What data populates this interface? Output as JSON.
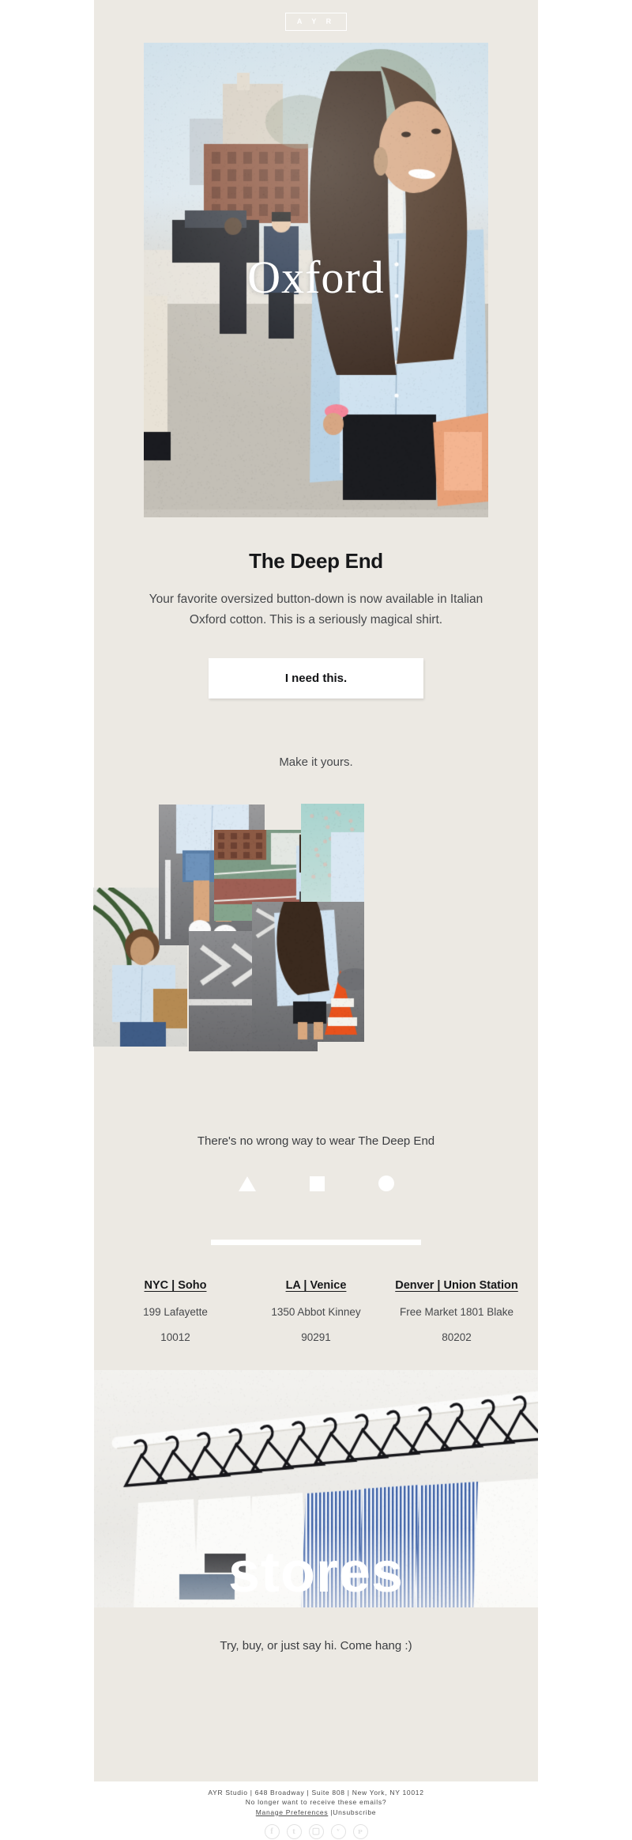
{
  "brand": {
    "logo": "A Y R"
  },
  "hero": {
    "overlay_word": "Oxford",
    "alt": "woman in light blue oxford button-down shirt on NYC street"
  },
  "promo": {
    "headline": "The Deep End",
    "body": "Your favorite oversized button-down is now available in Italian Oxford cotton. This is a seriously magical shirt.",
    "cta_label": "I need this.",
    "sub_line": "Make it yours."
  },
  "collage": {
    "tagline": "There's no wrong way to wear The Deep End",
    "shapes": [
      "triangle",
      "square",
      "circle"
    ]
  },
  "stores": {
    "locations": [
      {
        "name": "NYC | Soho",
        "address": "199 Lafayette",
        "zip": "10012"
      },
      {
        "name": "LA | Venice",
        "address": "1350 Abbot Kinney",
        "zip": "90291"
      },
      {
        "name": "Denver | Union Station",
        "address": "Free Market 1801 Blake",
        "zip": "80202"
      }
    ],
    "banner_word": "stores",
    "closing": "Try, buy, or just say hi. Come hang :)"
  },
  "footer": {
    "address": "AYR Studio | 648 Broadway | Suite 808 | New York, NY 10012",
    "optout_question": "No longer want to receive these emails?",
    "manage_label": "Manage Preferences",
    "separator": " |",
    "unsubscribe_label": "Unsubscribe",
    "social": [
      {
        "name": "facebook",
        "glyph": "f"
      },
      {
        "name": "tumblr",
        "glyph": "t"
      },
      {
        "name": "instagram",
        "glyph": "▢"
      },
      {
        "name": "twitter",
        "glyph": "ᵛ"
      },
      {
        "name": "pinterest",
        "glyph": "ᴘ"
      }
    ]
  },
  "colors": {
    "page_bg": "#ece9e3",
    "outer_bg": "#ffffff",
    "text_dark": "#17181a",
    "text_body": "#46484b",
    "white": "#ffffff"
  }
}
